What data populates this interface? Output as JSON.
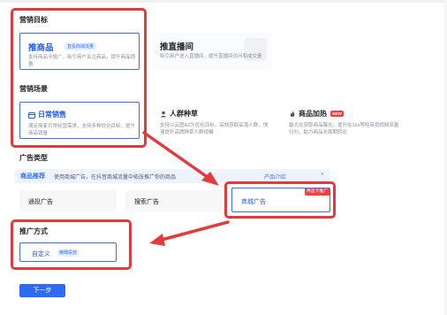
{
  "marketing_goal": {
    "heading": "营销目标",
    "cards": [
      {
        "title": "推商品",
        "tag": "直投商城流量",
        "desc": "支持商品卡投广，吸引用户关注商品，提升商品销量"
      },
      {
        "title": "推直播间",
        "desc": "吸引用户进入直播间，提升直播间访问和成交量"
      }
    ]
  },
  "marketing_scene": {
    "heading": "营销场景",
    "cards": [
      {
        "icon": "calendar-icon",
        "title": "日常销售",
        "desc": "满足商家日常经营需求，支持多种优化目标，提升商品销量"
      },
      {
        "icon": "people-icon",
        "title": "人群种草",
        "desc": "支持以云图A3为优化目标，高效获取高潜人群，快速提升品牌种草人群规模"
      },
      {
        "icon": "flame-icon",
        "title": "商品加热",
        "badge": "NEW",
        "desc": "最大化获取商品曝光，提升在15s等短带货视频流量行为，助力商品长尾期转化"
      }
    ]
  },
  "ad_type": {
    "heading": "广告类型",
    "banner": {
      "tag": "商品推荐",
      "text": "使用商城广告，在抖音商城流量中拓张推广你的商品",
      "link": "产品介绍",
      "close": "×"
    },
    "options": [
      {
        "label": "通投广告"
      },
      {
        "label": "搜索广告"
      },
      {
        "label": "商城广告",
        "badge": "商品卡推广"
      }
    ]
  },
  "promo_method": {
    "heading": "推广方式",
    "option": {
      "label": "自定义",
      "tag": "精细投放"
    }
  },
  "footer": {
    "next_label": "下一步"
  },
  "colors": {
    "accent": "#3370ff",
    "annotation_red": "#e23b3b",
    "badge_red": "#f53f3f"
  }
}
